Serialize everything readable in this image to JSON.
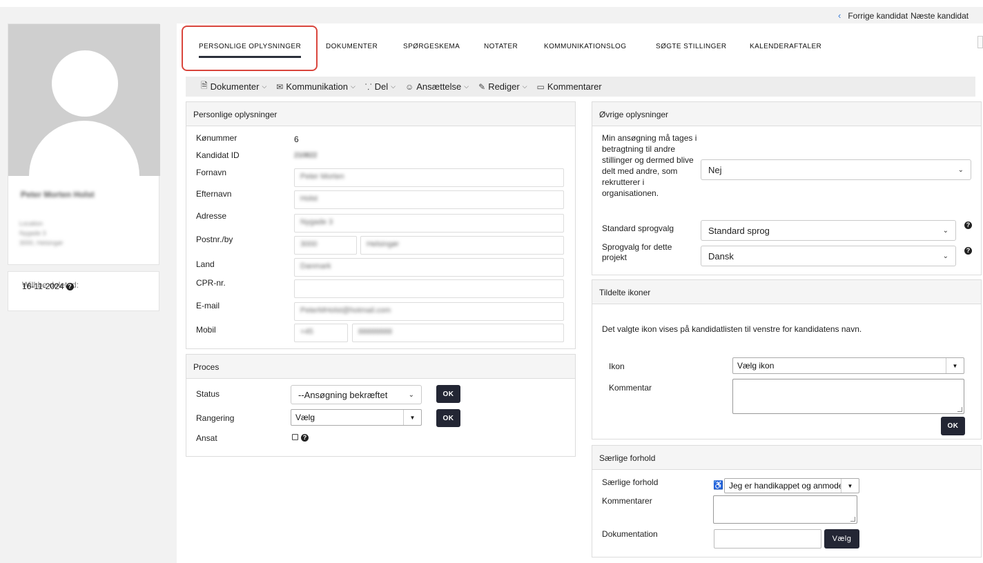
{
  "nav": {
    "prev": "Forrige kandidat",
    "next": "Næste kandidat"
  },
  "profile": {
    "name": "Peter Morten Holst",
    "location_label": "Location",
    "address": "Nygade 3",
    "city": "3000, Helsingør",
    "deleted_label": "Will be deleted:",
    "deleted_date": "16-11-2024"
  },
  "tabs": [
    "PERSONLIGE OPLYSNINGER",
    "DOKUMENTER",
    "SPØRGESKEMA",
    "NOTATER",
    "KOMMUNIKATIONSLOG",
    "SØGTE STILLINGER",
    "KALENDERAFTALER"
  ],
  "toolbar": [
    "Dokumenter",
    "Kommunikation",
    "Del",
    "Ansættelse",
    "Rediger",
    "Kommentarer"
  ],
  "personal": {
    "title": "Personlige oplysninger",
    "labels": {
      "konummer": "Kønummer",
      "kandidat_id": "Kandidat ID",
      "fornavn": "Fornavn",
      "efternavn": "Efternavn",
      "adresse": "Adresse",
      "postnr": "Postnr./by",
      "land": "Land",
      "cpr": "CPR-nr.",
      "email": "E-mail",
      "mobil": "Mobil"
    },
    "values": {
      "konummer": "6",
      "kandidat_id": "210822",
      "fornavn": "Peter Morten",
      "efternavn": "Holst",
      "adresse": "Nygade 3",
      "postnr": "3000",
      "by": "Helsingør",
      "land": "Danmark",
      "cpr": "",
      "email": "PeterMHolst@hotmail.com",
      "landekode": "+45",
      "mobil": "88888888"
    }
  },
  "proces": {
    "title": "Proces",
    "status_label": "Status",
    "status_value": "--Ansøgning bekræftet",
    "rangering_label": "Rangering",
    "rangering_value": "Vælg",
    "ansat_label": "Ansat",
    "ok": "OK"
  },
  "ovrige": {
    "title": "Øvrige oplysninger",
    "consent_label": "Min ansøgning må tages i betragtning til andre stillinger og dermed blive delt med andre, som rekrutterer i organisationen.",
    "consent_value": "Nej",
    "sprog_label": "Standard sprogvalg",
    "sprog_value": "Standard sprog",
    "projekt_label": "Sprogvalg for dette projekt",
    "projekt_value": "Dansk"
  },
  "ikoner": {
    "title": "Tildelte ikoner",
    "description": "Det valgte ikon vises på kandidatlisten til venstre for kandidatens navn.",
    "ikon_label": "Ikon",
    "ikon_value": "Vælg ikon",
    "kommentar_label": "Kommentar",
    "ok": "OK"
  },
  "saerlige": {
    "title": "Særlige forhold",
    "forhold_label": "Særlige forhold",
    "forhold_value": "Jeg er handikappet og anmoder",
    "kommentarer_label": "Kommentarer",
    "dok_label": "Dokumentation",
    "vaelg": "Vælg"
  },
  "colors": {
    "accent_dark": "#232634",
    "highlight": "#d9453c",
    "link": "#3a7bd5"
  }
}
